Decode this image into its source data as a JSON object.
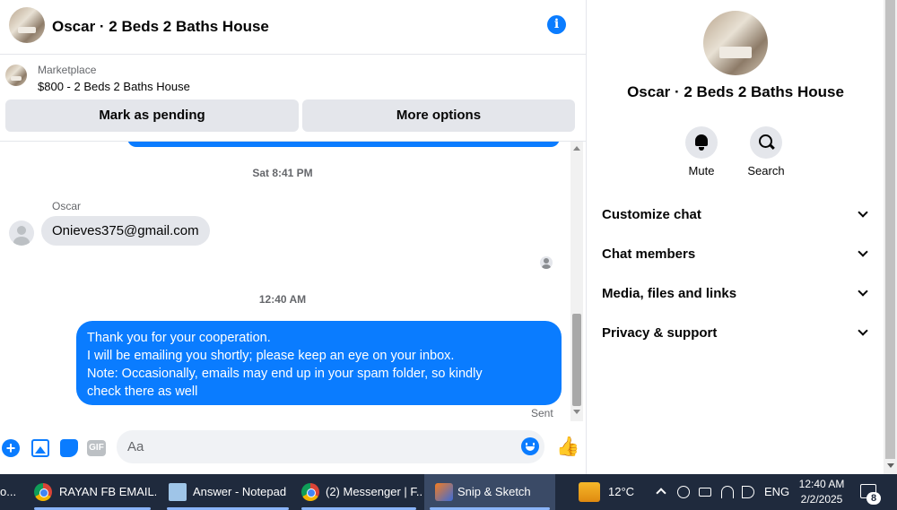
{
  "chat": {
    "header_title": "Oscar · 2 Beds 2 Baths House",
    "marketplace_label": "Marketplace",
    "listing_price": "$800 - 2 Beds 2 Baths House",
    "buttons": {
      "mark_pending": "Mark as pending",
      "more_options": "More options"
    },
    "messages": {
      "timestamp_1": "Sat 8:41 PM",
      "sender_name": "Oscar",
      "incoming_text": "Onieves375@gmail.com",
      "timestamp_2": "12:40 AM",
      "outgoing_lines": [
        "Thank you for your cooperation.",
        "I will be emailing you shortly; please keep an eye on your inbox.",
        "Note: Occasionally, emails may end up in your spam folder, so kindly",
        "check there as well"
      ],
      "status": "Sent"
    },
    "composer": {
      "placeholder": "Aa",
      "gif_label": "GIF"
    }
  },
  "info_panel": {
    "title": "Oscar · 2 Beds 2 Baths House",
    "actions": {
      "mute": "Mute",
      "search": "Search"
    },
    "sections": [
      "Customize chat",
      "Chat members",
      "Media, files and links",
      "Privacy & support"
    ]
  },
  "taskbar": {
    "items": [
      "o...",
      "RAYAN FB EMAIL...",
      "Answer - Notepad",
      "(2) Messenger | F...",
      "Snip & Sketch"
    ],
    "weather": "12°C",
    "language": "ENG",
    "time": "12:40 AM",
    "date": "2/2/2025",
    "notification_count": "8"
  },
  "colors": {
    "accent": "#0a7cff",
    "bubble_in": "#e4e6eb",
    "taskbar": "#1f2a3d"
  }
}
